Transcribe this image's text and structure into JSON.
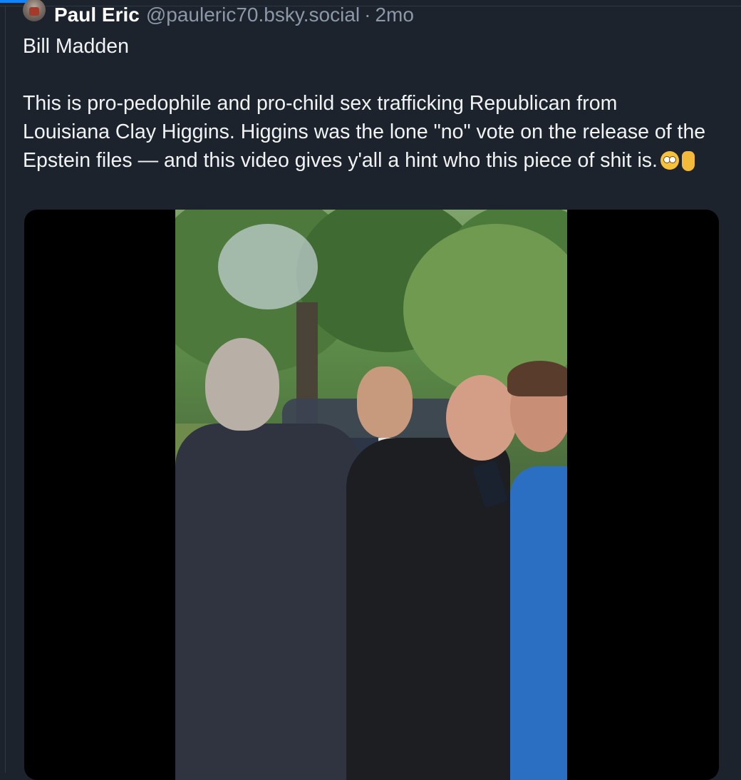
{
  "post": {
    "author": {
      "display_name": "Paul Eric",
      "handle": "@pauleric70.bsky.social",
      "separator": "·",
      "time_ago": "2mo"
    },
    "text": "Bill Madden\n\nThis is pro-pedophile and pro-child sex trafficking Republican from Louisiana Clay Higgins. Higgins was the lone \"no\" vote on the release of the Epstein files — and this video gives y'all a hint who this piece of shit is.",
    "emoji_icons": [
      "flushed-face-icon",
      "pointing-down-icon"
    ],
    "media": {
      "type": "video",
      "icon": "video-thumbnail"
    }
  },
  "colors": {
    "background": "#1c232d",
    "accent": "#1083fe",
    "muted_text": "#8c98a8",
    "border": "#2e3846"
  }
}
